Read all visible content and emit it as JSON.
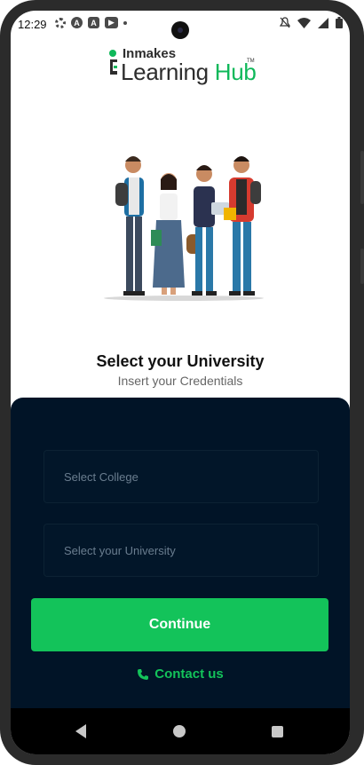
{
  "status_bar": {
    "time": "12:29",
    "icons_left": [
      "settings-icon",
      "a-icon",
      "a-box-icon",
      "youtube-icon",
      "dot-icon"
    ],
    "icons_right": [
      "mute-icon",
      "wifi-icon",
      "signal-icon",
      "battery-icon"
    ]
  },
  "logo": {
    "small_text": "Inmakes",
    "big_text_1": "Learning",
    "big_text_2": "Hub",
    "tm": "TM",
    "brand_color": "#0fb85a"
  },
  "heading": {
    "title": "Select your University",
    "subtitle": "Insert your Credentials"
  },
  "form": {
    "college_placeholder": "Select College",
    "university_placeholder": "Select your University",
    "continue_label": "Continue",
    "contact_label": "Contact us",
    "sheet_color": "#011427",
    "accent_color": "#13c35a"
  },
  "nav_bar": {
    "buttons": [
      "back-icon",
      "home-icon",
      "recents-icon"
    ]
  }
}
